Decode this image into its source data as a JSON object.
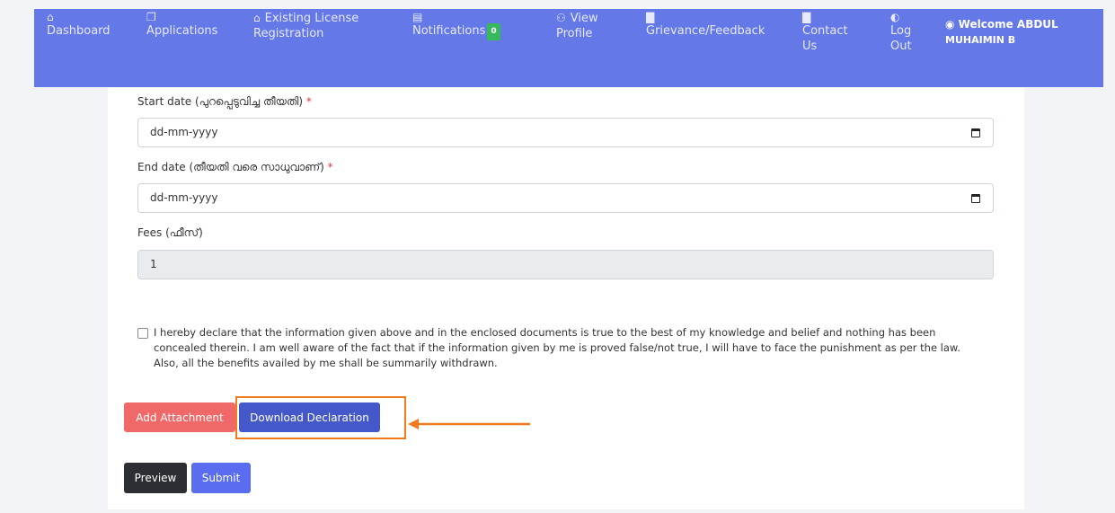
{
  "nav": {
    "items": [
      {
        "icon": "⌂",
        "label": "Dashboard"
      },
      {
        "icon": "❐",
        "label": "Applications"
      },
      {
        "icon": "⌂",
        "label": "Existing License Registration"
      },
      {
        "icon": "▤",
        "label": "Notifications",
        "badge": "0"
      },
      {
        "icon": "⚇",
        "label": "View Profile"
      },
      {
        "icon": "▇",
        "label": "Grievance/Feedback"
      },
      {
        "icon": "▇",
        "label": "Contact Us"
      },
      {
        "icon": "◐",
        "label": "Log Out"
      }
    ],
    "welcome": {
      "icon": "◉",
      "line1": "Welcome ABDUL",
      "line2": "MUHAIMIN B"
    }
  },
  "form": {
    "start_date": {
      "label": "Start date (പുറപ്പെടുവിച്ച തീയതി)",
      "required": "*",
      "placeholder": "dd-mm-yyyy"
    },
    "end_date": {
      "label": "End date (തീയതി വരെ സാധുവാണ്)",
      "required": "*",
      "placeholder": "dd-mm-yyyy"
    },
    "fees": {
      "label": "Fees (ഫീസ്)",
      "value": "1"
    },
    "declaration": "I hereby declare that the information given above and in the enclosed documents is true to the best of my knowledge and belief and nothing has been concealed therein. I am well aware of the fact that if the information given by me is proved false/not true, I will have to face the punishment as per the law. Also, all the benefits availed by me shall be summarily withdrawn."
  },
  "buttons": {
    "add_attachment": "Add Attachment",
    "download_declaration": "Download Declaration",
    "preview": "Preview",
    "submit": "Submit"
  },
  "colors": {
    "nav_bg": "#6478e8",
    "add_attachment": "#f06868",
    "download_declaration": "#4458c9",
    "preview": "#2b2e33",
    "submit": "#5a6cf0",
    "highlight": "#f07b1f"
  }
}
